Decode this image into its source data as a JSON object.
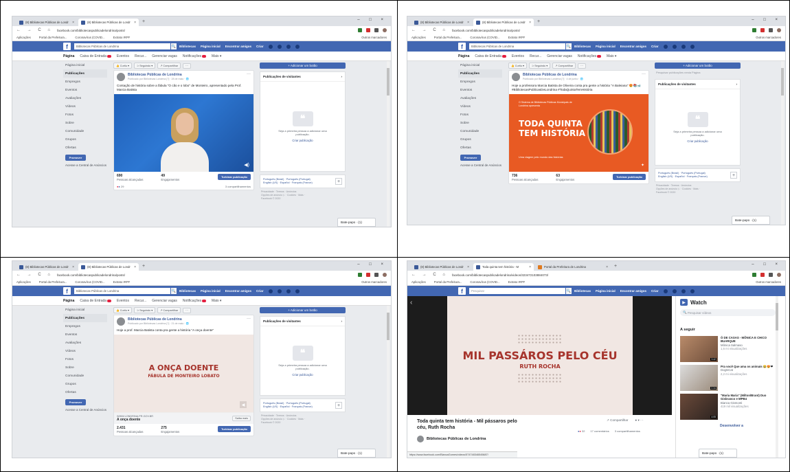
{
  "browser": {
    "window_controls": "– □ ×",
    "nav_icons": "← → C ⌂",
    "new_tab": "+",
    "tab_close": "×",
    "bookmarks": [
      "Aplicações",
      "Portal da Prefeitura...",
      "Coronavírus (COVID...",
      "Extrato IRPF"
    ],
    "bookmarks_other": "Outros marcadores"
  },
  "fb": {
    "logo": "f",
    "search_value": "Bibliotecas Públicas de Londrina",
    "search_placeholder": "Pesquisar",
    "search_icon": "🔍",
    "nav": [
      "Bibliotecas",
      "Página inicial",
      "Encontrar amigos",
      "Criar"
    ],
    "subnav": [
      "Página",
      "Caixa de Entrada",
      "Eventos",
      "Recur...",
      "Gerenciar vagas",
      "Notificações",
      "Mais ▾"
    ],
    "sidebar": [
      "Página inicial",
      "Publicações",
      "Empregos",
      "Eventos",
      "Avaliações",
      "Vídeos",
      "Fotos",
      "Sobre",
      "Comunidade",
      "Grupos",
      "Ofertas"
    ],
    "promote": "Promover",
    "ad_center": "Acesse a Central de Anúncios",
    "toolbar": [
      "👍 Curtiu ▾",
      "⊃ Seguindo ▾",
      "↗ Compartilhar",
      "···"
    ],
    "page_name": "Bibliotecas Públicas de Londrina",
    "add_button": "+ Adicionar um botão",
    "search_posts_placeholder": "Pesquisar publicações nesta Página",
    "visitor_posts": "Publicações de visitantes",
    "visitor_arrow": "›",
    "visitor_empty": "Seja a primeira pessoa a adicionar uma publicação.",
    "create_post": "Criar publicação",
    "lang_1": "Português (Brasil) · Português (Portugal)",
    "lang_2": "English (US) · Español · Français (France)",
    "lang_plus": "+",
    "footer_1": "Privacidade · Termos · Anúncios",
    "footer_2": "Opções de anúncio ▷ · Cookies · Mais ·",
    "footer_3": "Facebook © 2020",
    "boost": "Turbinar publicação",
    "reach_label": "Pessoas alcançadas",
    "engagement_label": "Engajamentos",
    "chat": "Bate-papo · (1)"
  },
  "panel1": {
    "tabs": [
      "(8) Bibliotecas Públicas de Londr",
      "(8) Bibliotecas Públicas de Londr"
    ],
    "url": "facebook.com/bibliotecaspublicadelondrina/posts/",
    "meta": "Publicado por Bibliotecas Londrina [?] · 28 de maio · 🌐",
    "text": "Contação de história sobre a fábula \"O cão e o lobo\" de Monteiro, apresentado pela Prof. Marcia Batista",
    "reach": "690",
    "engagement": "49",
    "reactions": "29",
    "shares": "3 compartilhamentos"
  },
  "panel2": {
    "tabs": [
      "(8) Bibliotecas Públicas de Londr",
      "(8) Bibliotecas Públicas de Londr"
    ],
    "url": "facebook.com/bibliotecaspublicadelondrina/posts/",
    "meta": "Publicado por Bibliotecas Londrina [?] · 4 de junho · 🌐",
    "text": "Hoje a professora Marcia Batista de Oliveira conta pra gente a história \"A Baleiana\" 😍📚🐋 #BibliotecasPublicasDeLondrina #TodaQuintaTemHistória",
    "banner_small": "O Sistema de Bibliotecas Públicas Municipais de Londrina apresenta",
    "banner_title_1": "TODA QUINTA",
    "banner_title_2": "TEM HISTÓRIA",
    "banner_sub": "Uma viagem pelo mundo das histórias",
    "reach": "736",
    "engagement": "63"
  },
  "panel3": {
    "tabs": [
      "(8) Bibliotecas Públicas de Londr",
      "(8) Bibliotecas Públicas de Londr"
    ],
    "url": "facebook.com/bibliotecaspublicadelondrina/posts/",
    "meta": "Publicado por Bibliotecas Londrina [?] · 21 de maio · 🌐",
    "text": "Hoje a prof. Marcia Batista conta pra gente a história \"A onça doente\"",
    "video_title": "A ONÇA DOENTE",
    "video_sub": "FÁBULA DE MONTEIRO LOBATO",
    "link_domain": "WWW.LONDRINA.PR.GOV.BR",
    "link_title": "A onça doente",
    "link_button": "Saiba mais",
    "reach": "2.431",
    "engagement": "275"
  },
  "panel4": {
    "tabs": [
      "(8) Bibliotecas Públicas de Londr",
      "Toda quinta tem história - M",
      "Portal da Prefeitura de Londrina"
    ],
    "url": "facebook.com/bibliotecaspublicadelondrina/videos/323472103884073/",
    "video_title": "MIL PASSÁROS PELO CÉU",
    "video_sub": "RUTH ROCHA",
    "post_title": "Toda quinta tem história - Mil pássaros pelo céu, Ruth Rocha",
    "author": "Bibliotecas Públicas de Londrina",
    "share": "↗ Compartilhar",
    "more": "··· ",
    "reactions": "32",
    "comments": "17 comentários",
    "shares": "3 compartilhamentos",
    "status_url": "https://www.facebook.com/BiancaGomes/videos/574748346545687/",
    "watch": "Watch",
    "watch_search": "Pesquisar vídeos",
    "next": "A seguir",
    "items": [
      {
        "title": "Ó DE CASAS - MÔNICA E CHICO BUARQUE",
        "author": "Mônica Salmaso",
        "views": "1,6 mi visualizações",
        "dur": "3:42"
      },
      {
        "title": "Pra você Que ama os animais 😂😍❤",
        "author": "DogIsCat",
        "views": "2,2 mi visualizações",
        "dur": "0:34"
      },
      {
        "title": "\"Maria Maria\" (Milton/Brant) Duo Gisbranco e MPB4",
        "author": "Bianca Gismonti",
        "views": "419 mil visualizações",
        "dur": "4:05"
      }
    ],
    "develop": "Desenvolver a"
  },
  "colors": {
    "fb_blue": "#4267b2",
    "banner_orange": "#e85a23",
    "video_bg": "#f1e7e3",
    "title_red": "#a6342c"
  }
}
